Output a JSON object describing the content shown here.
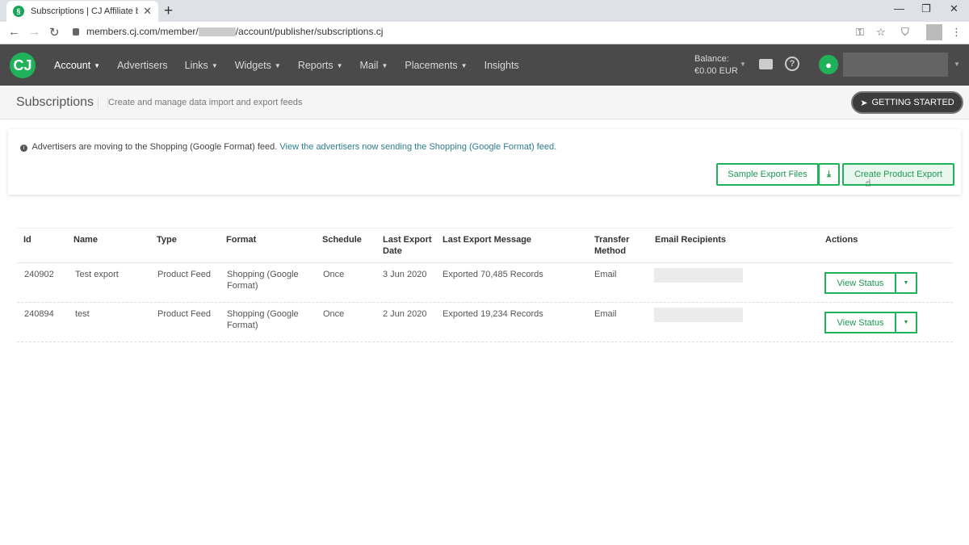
{
  "browser": {
    "tab_title": "Subscriptions | CJ Affiliate by Con",
    "url_prefix": "members.cj.com/member/",
    "url_suffix": "/account/publisher/subscriptions.cj"
  },
  "nav": {
    "logo": "CJ",
    "items": [
      {
        "label": "Account",
        "caret": true
      },
      {
        "label": "Advertisers",
        "caret": false
      },
      {
        "label": "Links",
        "caret": true
      },
      {
        "label": "Widgets",
        "caret": true
      },
      {
        "label": "Reports",
        "caret": true
      },
      {
        "label": "Mail",
        "caret": true
      },
      {
        "label": "Placements",
        "caret": true
      },
      {
        "label": "Insights",
        "caret": false
      }
    ],
    "balance_label": "Balance:",
    "balance_value": "€0.00 EUR"
  },
  "header": {
    "title": "Subscriptions",
    "subtitle": "Create and manage data import and export feeds",
    "getting_started": "GETTING STARTED"
  },
  "notice": {
    "text": "Advertisers are moving to the Shopping (Google Format) feed.",
    "link": "View the advertisers now sending the Shopping (Google Format) feed."
  },
  "buttons": {
    "sample_export": "Sample Export Files",
    "create_export": "Create Product Export"
  },
  "table": {
    "headers": [
      "Id",
      "Name",
      "Type",
      "Format",
      "Schedule",
      "Last Export Date",
      "Last Export Message",
      "Transfer Method",
      "Email Recipients",
      "Actions"
    ],
    "rows": [
      {
        "id": "240902",
        "name": "Test export",
        "type": "Product Feed",
        "format": "Shopping (Google Format)",
        "schedule": "Once",
        "date": "3 Jun 2020",
        "message": "Exported 70,485 Records",
        "transfer": "Email",
        "action": "View Status"
      },
      {
        "id": "240894",
        "name": "test",
        "type": "Product Feed",
        "format": "Shopping (Google Format)",
        "schedule": "Once",
        "date": "2 Jun 2020",
        "message": "Exported 19,234 Records",
        "transfer": "Email",
        "action": "View Status"
      }
    ]
  },
  "colors": {
    "brand_green": "#1fb25a",
    "nav_bg": "#4a4a4a",
    "link": "#2d7d8c"
  }
}
